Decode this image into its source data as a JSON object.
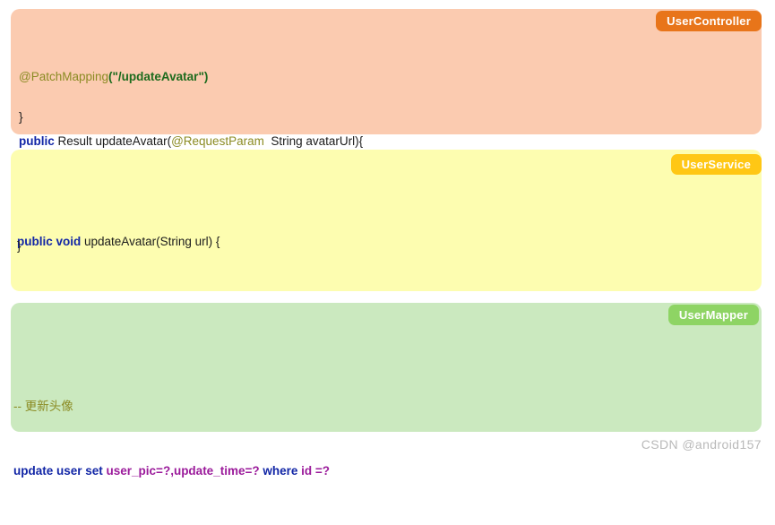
{
  "blocks": [
    {
      "id": "user-controller",
      "badge_label": "UserController",
      "badge_color": "#e8751a",
      "panel_color": "#fbcbb0",
      "lines": [
        {
          "tokens": [
            {
              "text": "@PatchMapping",
              "style": "annotation"
            },
            {
              "text": "(",
              "style": "string"
            },
            {
              "text": "\"/updateAvatar\"",
              "style": "string"
            },
            {
              "text": ")",
              "style": "string"
            }
          ]
        },
        {
          "tokens": [
            {
              "text": "public",
              "style": "keyword"
            },
            {
              "text": " Result updateAvatar(",
              "style": "plain"
            },
            {
              "text": "@RequestParam",
              "style": "annotation"
            },
            {
              "text": "  String avatarUrl){",
              "style": "plain"
            }
          ]
        }
      ],
      "closing_brace": "}"
    },
    {
      "id": "user-service",
      "badge_label": "UserService",
      "badge_color": "#ffc715",
      "panel_color": "#fdfdb0",
      "lines": [
        {
          "tokens": [
            {
              "text": "public void",
              "style": "keyword"
            },
            {
              "text": " updateAvatar(String url) {",
              "style": "plain"
            }
          ]
        }
      ],
      "closing_brace": "}"
    },
    {
      "id": "user-mapper",
      "badge_label": "UserMapper",
      "badge_color": "#8ed464",
      "panel_color": "#cbe9bf",
      "lines": [
        {
          "tokens": [
            {
              "text": "-- 更新头像",
              "style": "comment"
            }
          ]
        },
        {
          "tokens": [
            {
              "text": "update user set ",
              "style": "sqlkey"
            },
            {
              "text": "user_pic=?,update_time=?",
              "style": "sqlcol"
            },
            {
              "text": " where ",
              "style": "sqlkey"
            },
            {
              "text": "id =?",
              "style": "sqlcol"
            }
          ]
        }
      ],
      "closing_brace": ""
    }
  ],
  "watermark": "CSDN @android157"
}
